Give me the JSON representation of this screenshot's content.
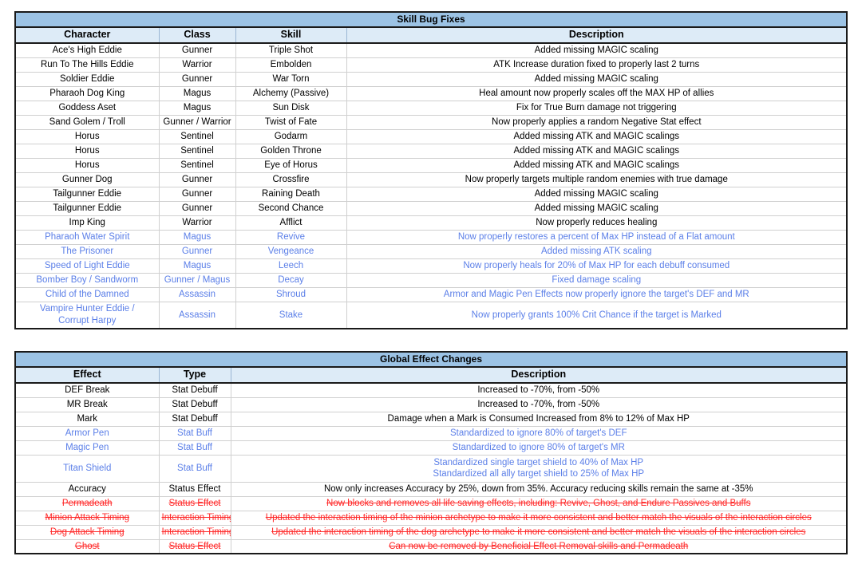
{
  "tables": [
    {
      "id": "skill-bug-fixes",
      "title": "Skill Bug Fixes",
      "columns": [
        "Character",
        "Class",
        "Skill",
        "Description"
      ],
      "rows": [
        {
          "style": "normal",
          "cells": [
            "Ace's High Eddie",
            "Gunner",
            "Triple Shot",
            "Added missing MAGIC scaling"
          ]
        },
        {
          "style": "normal",
          "cells": [
            "Run To The Hills Eddie",
            "Warrior",
            "Embolden",
            "ATK Increase duration fixed to properly last 2 turns"
          ]
        },
        {
          "style": "normal",
          "cells": [
            "Soldier Eddie",
            "Gunner",
            "War Torn",
            "Added missing MAGIC scaling"
          ]
        },
        {
          "style": "normal",
          "cells": [
            "Pharaoh Dog King",
            "Magus",
            "Alchemy (Passive)",
            "Heal amount now properly scales off the MAX HP of allies"
          ]
        },
        {
          "style": "normal",
          "cells": [
            "Goddess Aset",
            "Magus",
            "Sun Disk",
            "Fix for True Burn damage not triggering"
          ]
        },
        {
          "style": "normal",
          "cells": [
            "Sand Golem / Troll",
            "Gunner / Warrior",
            "Twist of Fate",
            "Now properly applies a random Negative Stat effect"
          ]
        },
        {
          "style": "normal",
          "cells": [
            "Horus",
            "Sentinel",
            "Godarm",
            "Added missing ATK and MAGIC scalings"
          ]
        },
        {
          "style": "normal",
          "cells": [
            "Horus",
            "Sentinel",
            "Golden Throne",
            "Added missing ATK and MAGIC scalings"
          ]
        },
        {
          "style": "normal",
          "cells": [
            "Horus",
            "Sentinel",
            "Eye of Horus",
            "Added missing ATK and MAGIC scalings"
          ]
        },
        {
          "style": "normal",
          "cells": [
            "Gunner Dog",
            "Gunner",
            "Crossfire",
            "Now properly targets multiple random enemies with true damage"
          ]
        },
        {
          "style": "normal",
          "cells": [
            "Tailgunner Eddie",
            "Gunner",
            "Raining Death",
            "Added missing MAGIC scaling"
          ]
        },
        {
          "style": "normal",
          "cells": [
            "Tailgunner Eddie",
            "Gunner",
            "Second Chance",
            "Added missing MAGIC scaling"
          ]
        },
        {
          "style": "normal",
          "cells": [
            "Imp King",
            "Warrior",
            "Afflict",
            "Now properly reduces healing"
          ]
        },
        {
          "style": "blue",
          "cells": [
            "Pharaoh Water Spirit",
            "Magus",
            "Revive",
            "Now properly restores a percent of Max HP instead of a Flat amount"
          ]
        },
        {
          "style": "blue",
          "cells": [
            "The Prisoner",
            "Gunner",
            "Vengeance",
            "Added missing ATK scaling"
          ]
        },
        {
          "style": "blue",
          "cells": [
            "Speed of Light Eddie",
            "Magus",
            "Leech",
            "Now properly heals for 20% of Max HP for each debuff consumed"
          ]
        },
        {
          "style": "blue",
          "cells": [
            "Bomber Boy / Sandworm",
            "Gunner / Magus",
            "Decay",
            "Fixed damage scaling"
          ]
        },
        {
          "style": "blue",
          "cells": [
            "Child of the Damned",
            "Assassin",
            "Shroud",
            "Armor and Magic Pen Effects now properly ignore the target's DEF and MR"
          ]
        },
        {
          "style": "blue",
          "tall": true,
          "cells": [
            [
              "Vampire Hunter Eddie /",
              "Corrupt Harpy"
            ],
            "Assassin",
            "Stake",
            "Now properly grants 100% Crit Chance if the target is Marked"
          ]
        }
      ]
    },
    {
      "id": "global-effect-changes",
      "title": "Global Effect Changes",
      "columns": [
        "Effect",
        "Type",
        "Description"
      ],
      "rows": [
        {
          "style": "normal",
          "cells": [
            "DEF Break",
            "Stat Debuff",
            "Increased to -70%, from -50%"
          ]
        },
        {
          "style": "normal",
          "cells": [
            "MR Break",
            "Stat Debuff",
            "Increased to -70%, from -50%"
          ]
        },
        {
          "style": "normal",
          "cells": [
            "Mark",
            "Stat Debuff",
            "Damage when a Mark is Consumed Increased from 8% to 12% of Max HP"
          ]
        },
        {
          "style": "blue",
          "cells": [
            "Armor Pen",
            "Stat Buff",
            "Standardized to ignore 80% of target's DEF"
          ]
        },
        {
          "style": "blue",
          "cells": [
            "Magic Pen",
            "Stat Buff",
            "Standardized to ignore 80% of target's MR"
          ]
        },
        {
          "style": "blue",
          "tall": true,
          "cells": [
            "Titan Shield",
            "Stat Buff",
            [
              "Standardized single target shield to 40% of Max HP",
              "Standardized all ally target shield to 25% of Max HP"
            ]
          ]
        },
        {
          "style": "normal",
          "cells": [
            "Accuracy",
            "Status Effect",
            "Now only increases Accuracy by 25%, down from 35%. Accuracy reducing skills remain the same at -35%"
          ]
        },
        {
          "style": "red",
          "cells": [
            "Permadeath",
            "Status Effect",
            "Now blocks and removes all life saving effects, including: Revive, Ghost, and Endure Passives and Buffs"
          ]
        },
        {
          "style": "red",
          "cells": [
            "Minion Attack Timing",
            "Interaction Timing",
            "Updated the interaction timing of the minion archetype to make it more consistent and better match the visuals of the interaction circles"
          ]
        },
        {
          "style": "red",
          "cells": [
            "Dog Attack Timing",
            "Interaction Timing",
            "Updated the interaction timing of the dog archetype to make it more consistent and better match the visuals of the interaction circles"
          ]
        },
        {
          "style": "red",
          "cells": [
            "Ghost",
            "Status Effect",
            "Can now be removed by Beneficial Effect Removal skills and Permadeath"
          ]
        }
      ]
    }
  ],
  "colors": {
    "title_bg": "#9cc3e5",
    "header_bg": "#ddebf7",
    "blue_text": "#5b7fe8",
    "red_text": "#ff2a2a",
    "border": "#1a1a1a"
  },
  "column_widths": {
    "skill-bug-fixes": [
      180,
      96,
      139,
      627
    ],
    "global-effect-changes": [
      180,
      90,
      772
    ]
  }
}
